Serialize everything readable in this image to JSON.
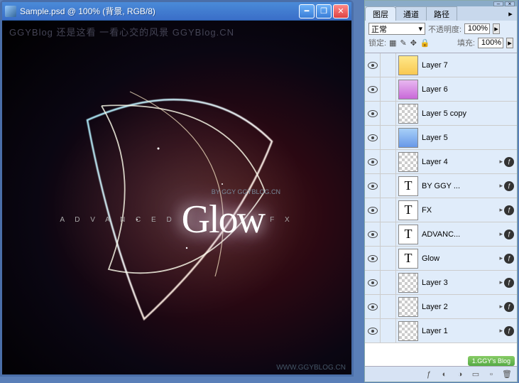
{
  "window": {
    "title": "Sample.psd @ 100% (背景, RGB/8)"
  },
  "canvas": {
    "watermark_top": "GGYBlog 还是这看 一看心交的风景 GGYBlog.CN",
    "watermark_bottom": "WWW.GGYBLOG.CN",
    "text_advanced": "A D V A N C E D",
    "text_glow": "Glow",
    "text_fx": "F X",
    "text_byline": "BY GGY  GGYBLOG.CN"
  },
  "panel": {
    "tabs": [
      "图层",
      "通道",
      "路径"
    ],
    "blend_label": "",
    "blend_mode": "正常",
    "opacity_label": "不透明度:",
    "opacity_value": "100%",
    "lock_label": "锁定:",
    "fill_label": "填充:",
    "fill_value": "100%"
  },
  "layers": [
    {
      "name": "Layer 7",
      "type": "raster",
      "swatch": "linear-gradient(#ffe88a,#f8c850)",
      "fx": false
    },
    {
      "name": "Layer 6",
      "type": "raster",
      "swatch": "linear-gradient(#e8b8f0,#c868d8)",
      "fx": false
    },
    {
      "name": "Layer 5 copy",
      "type": "raster",
      "swatch": "checker",
      "fx": false
    },
    {
      "name": "Layer 5",
      "type": "raster",
      "swatch": "linear-gradient(#a8d0f8,#6898e8)",
      "fx": false
    },
    {
      "name": "Layer 4",
      "type": "raster",
      "swatch": "checker",
      "fx": true
    },
    {
      "name": "BY GGY ...",
      "type": "text",
      "fx": true
    },
    {
      "name": "FX",
      "type": "text",
      "fx": true
    },
    {
      "name": "ADVANC...",
      "type": "text",
      "fx": true
    },
    {
      "name": "Glow",
      "type": "text",
      "fx": true
    },
    {
      "name": "Layer 3",
      "type": "raster",
      "swatch": "checker",
      "fx": true
    },
    {
      "name": "Layer 2",
      "type": "raster",
      "swatch": "checker",
      "fx": true
    },
    {
      "name": "Layer 1",
      "type": "raster",
      "swatch": "checker",
      "fx": true
    }
  ],
  "badge": "1.GGY's Blog",
  "glyphs": {
    "T": "T",
    "tri": "▸"
  }
}
